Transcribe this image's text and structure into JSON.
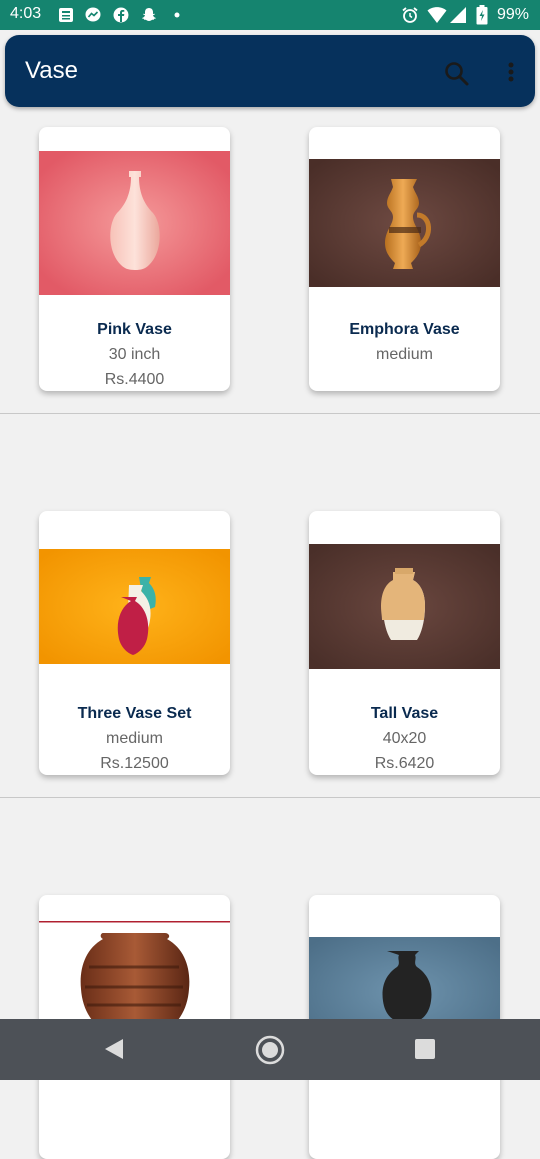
{
  "status_bar": {
    "time": "4:03",
    "battery": "99%",
    "left_icons": [
      "news-icon",
      "messenger-icon",
      "facebook-icon",
      "snapchat-icon",
      "dot-icon"
    ],
    "right_icons": [
      "alarm-icon",
      "wifi-icon",
      "signal-icon",
      "battery-icon"
    ]
  },
  "app_bar": {
    "title": "Vase",
    "background": "#06315c",
    "actions": [
      "search-icon",
      "more-vert-icon"
    ]
  },
  "products": [
    {
      "name": "Pink Vase",
      "size": "30 inch",
      "price": "Rs.4400"
    },
    {
      "name": "Emphora Vase",
      "size": "medium",
      "price": ""
    },
    {
      "name": "Three Vase Set",
      "size": "medium",
      "price": "Rs.12500"
    },
    {
      "name": "Tall Vase",
      "size": "40x20",
      "price": "Rs.6420"
    },
    {
      "name": "",
      "size": "",
      "price": ""
    },
    {
      "name": "",
      "size": "",
      "price": ""
    }
  ],
  "nav_bar": {
    "buttons": [
      "back-icon",
      "home-icon",
      "recents-icon"
    ]
  }
}
